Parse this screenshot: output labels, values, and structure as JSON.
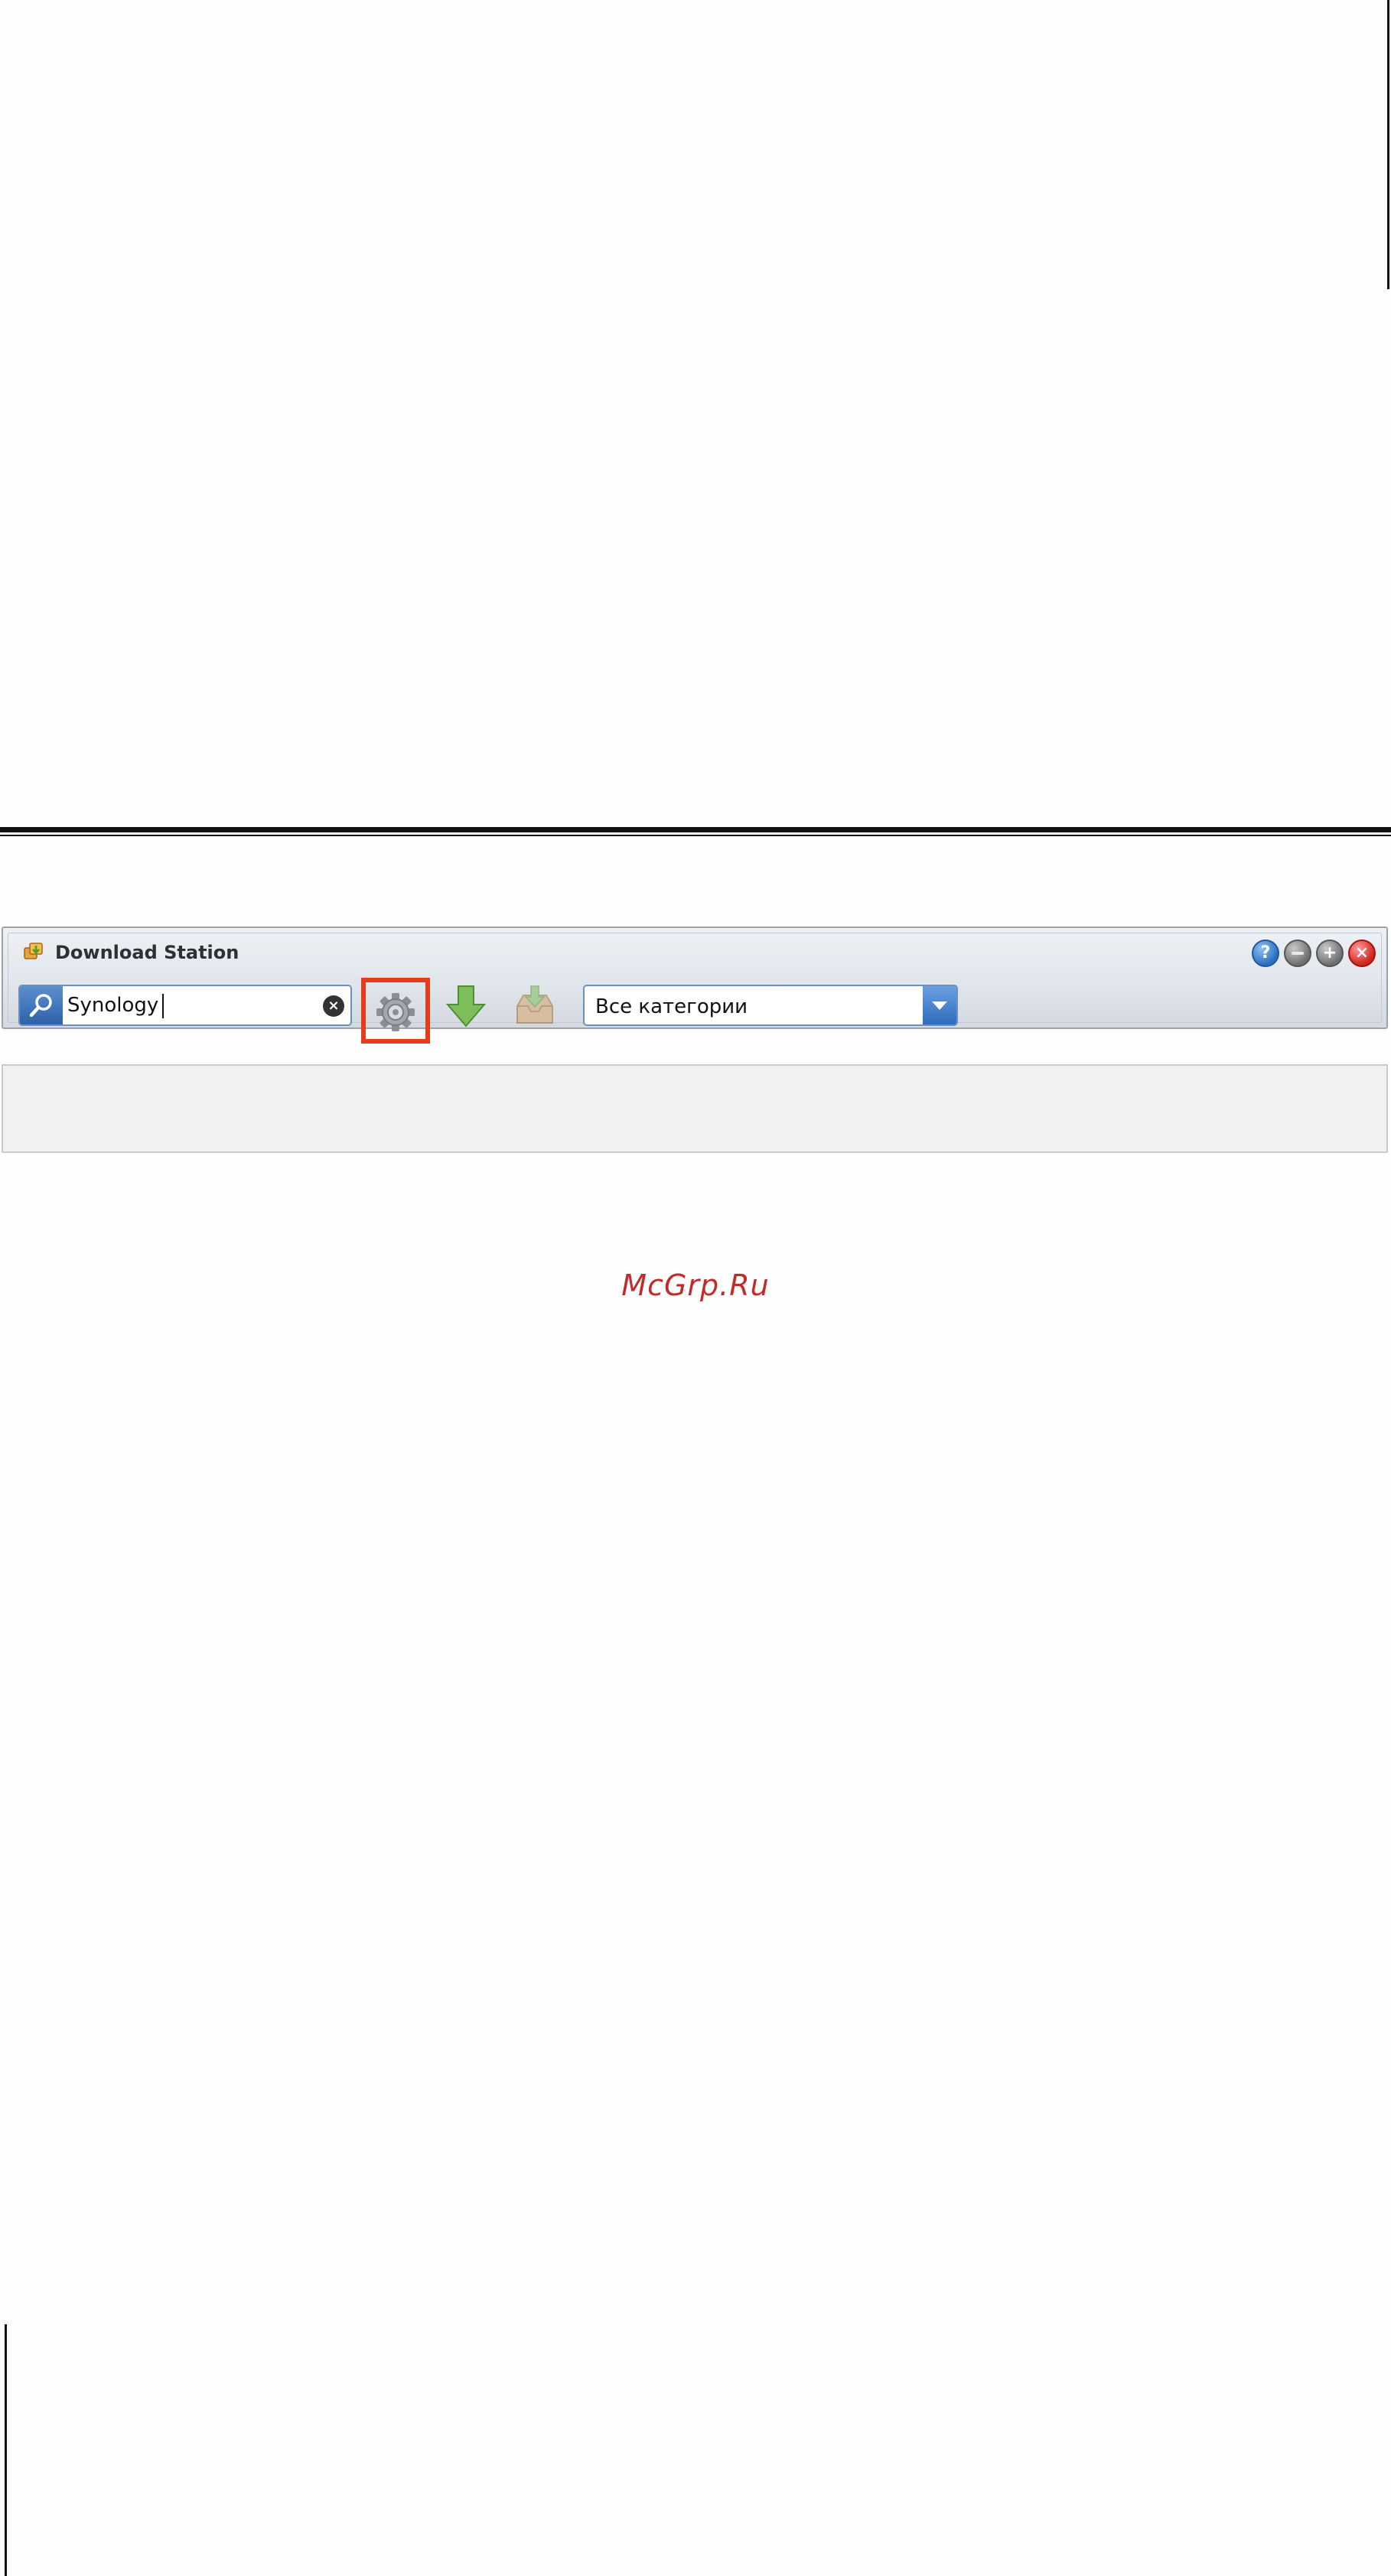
{
  "window": {
    "title": "Download Station",
    "app_icon": "download-station-icon",
    "controls": {
      "help_icon": "question-mark-icon",
      "minimize_icon": "minimize-icon",
      "maximize_icon": "maximize-icon",
      "close_icon": "close-icon"
    }
  },
  "toolbar": {
    "search": {
      "icon": "search-icon",
      "value": "Synology",
      "clear_icon": "clear-icon"
    },
    "settings_icon": "gear-icon",
    "download_icon": "download-arrow-icon",
    "inbox_icon": "inbox-download-icon",
    "category": {
      "selected": "Все категории",
      "arrow_icon": "chevron-down-icon"
    },
    "highlight_color": "#e53c1a"
  },
  "watermark": {
    "text": "McGrp.Ru"
  },
  "colors": {
    "accent": "#2d62a8",
    "highlight": "#e53c1a",
    "watermark": "#c42a2a"
  }
}
